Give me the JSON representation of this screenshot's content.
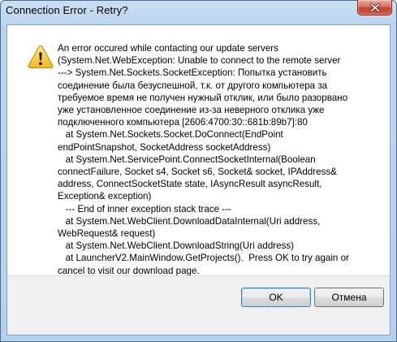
{
  "window": {
    "title": "Connection Error - Retry?",
    "close_icon": "close-x-icon"
  },
  "dialog": {
    "icon": "warning-icon",
    "message_lines": [
      "An error occured while contacting our update servers",
      "(System.Net.WebException: Unable to connect to the remote server",
      "---> System.Net.Sockets.SocketException: Попытка установить",
      "соединение была безуспешной, т.к. от другого компьютера за",
      "требуемое время не получен нужный отклик, или было разорвано",
      "уже установленное соединение из-за неверного отклика уже",
      "подключенного компьютера [2606:4700:30::681b:89b7]:80",
      "   at System.Net.Sockets.Socket.DoConnect(EndPoint",
      "endPointSnapshot, SocketAddress socketAddress)",
      "   at System.Net.ServicePoint.ConnectSocketInternal(Boolean",
      "connectFailure, Socket s4, Socket s6, Socket& socket, IPAddress&",
      "address, ConnectSocketState state, IAsyncResult asyncResult,",
      "Exception& exception)",
      "   --- End of inner exception stack trace ---",
      "   at System.Net.WebClient.DownloadDataInternal(Uri address,",
      "WebRequest& request)",
      "   at System.Net.WebClient.DownloadString(Uri address)",
      "   at LauncherV2.MainWindow.GetProjects().  Press OK to try again or",
      "cancel to visit our download page."
    ]
  },
  "buttons": {
    "ok_label": "OK",
    "cancel_label": "Отмена"
  },
  "colors": {
    "frame": "#bcd5ee",
    "close_button": "#c2422a",
    "warning": "#f2c52b",
    "footer": "#f0f0f0"
  }
}
